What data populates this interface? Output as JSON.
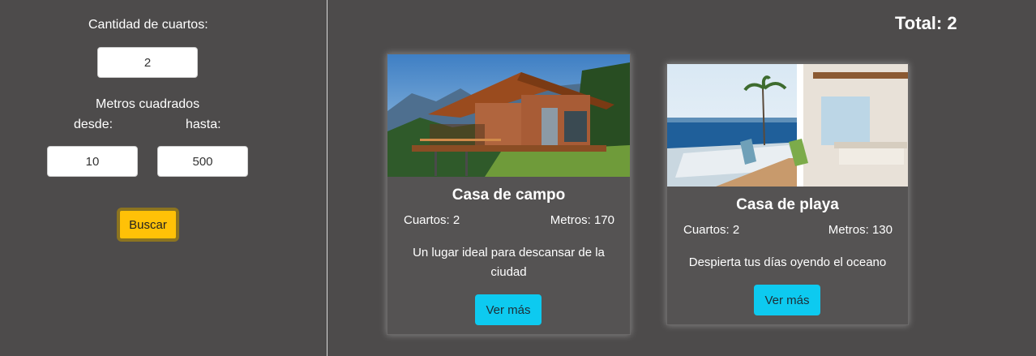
{
  "filters": {
    "rooms_label": "Cantidad de cuartos:",
    "rooms_value": "2",
    "meters_label": "Metros cuadrados",
    "from_label": "desde:",
    "to_label": "hasta:",
    "from_value": "10",
    "to_value": "500",
    "search_button": "Buscar"
  },
  "results": {
    "total_label": "Total: 2"
  },
  "cards": [
    {
      "title": "Casa de campo",
      "rooms": "Cuartos: 2",
      "meters": "Metros: 170",
      "description": "Un lugar ideal para descansar de la ciudad",
      "button": "Ver más"
    },
    {
      "title": "Casa de playa",
      "rooms": "Cuartos: 2",
      "meters": "Metros: 130",
      "description": "Despierta tus días oyendo el oceano",
      "button": "Ver más"
    }
  ],
  "colors": {
    "background": "#4d4b4b",
    "card": "#555353",
    "search_button": "#ffc107",
    "details_button": "#0dcaf0"
  }
}
